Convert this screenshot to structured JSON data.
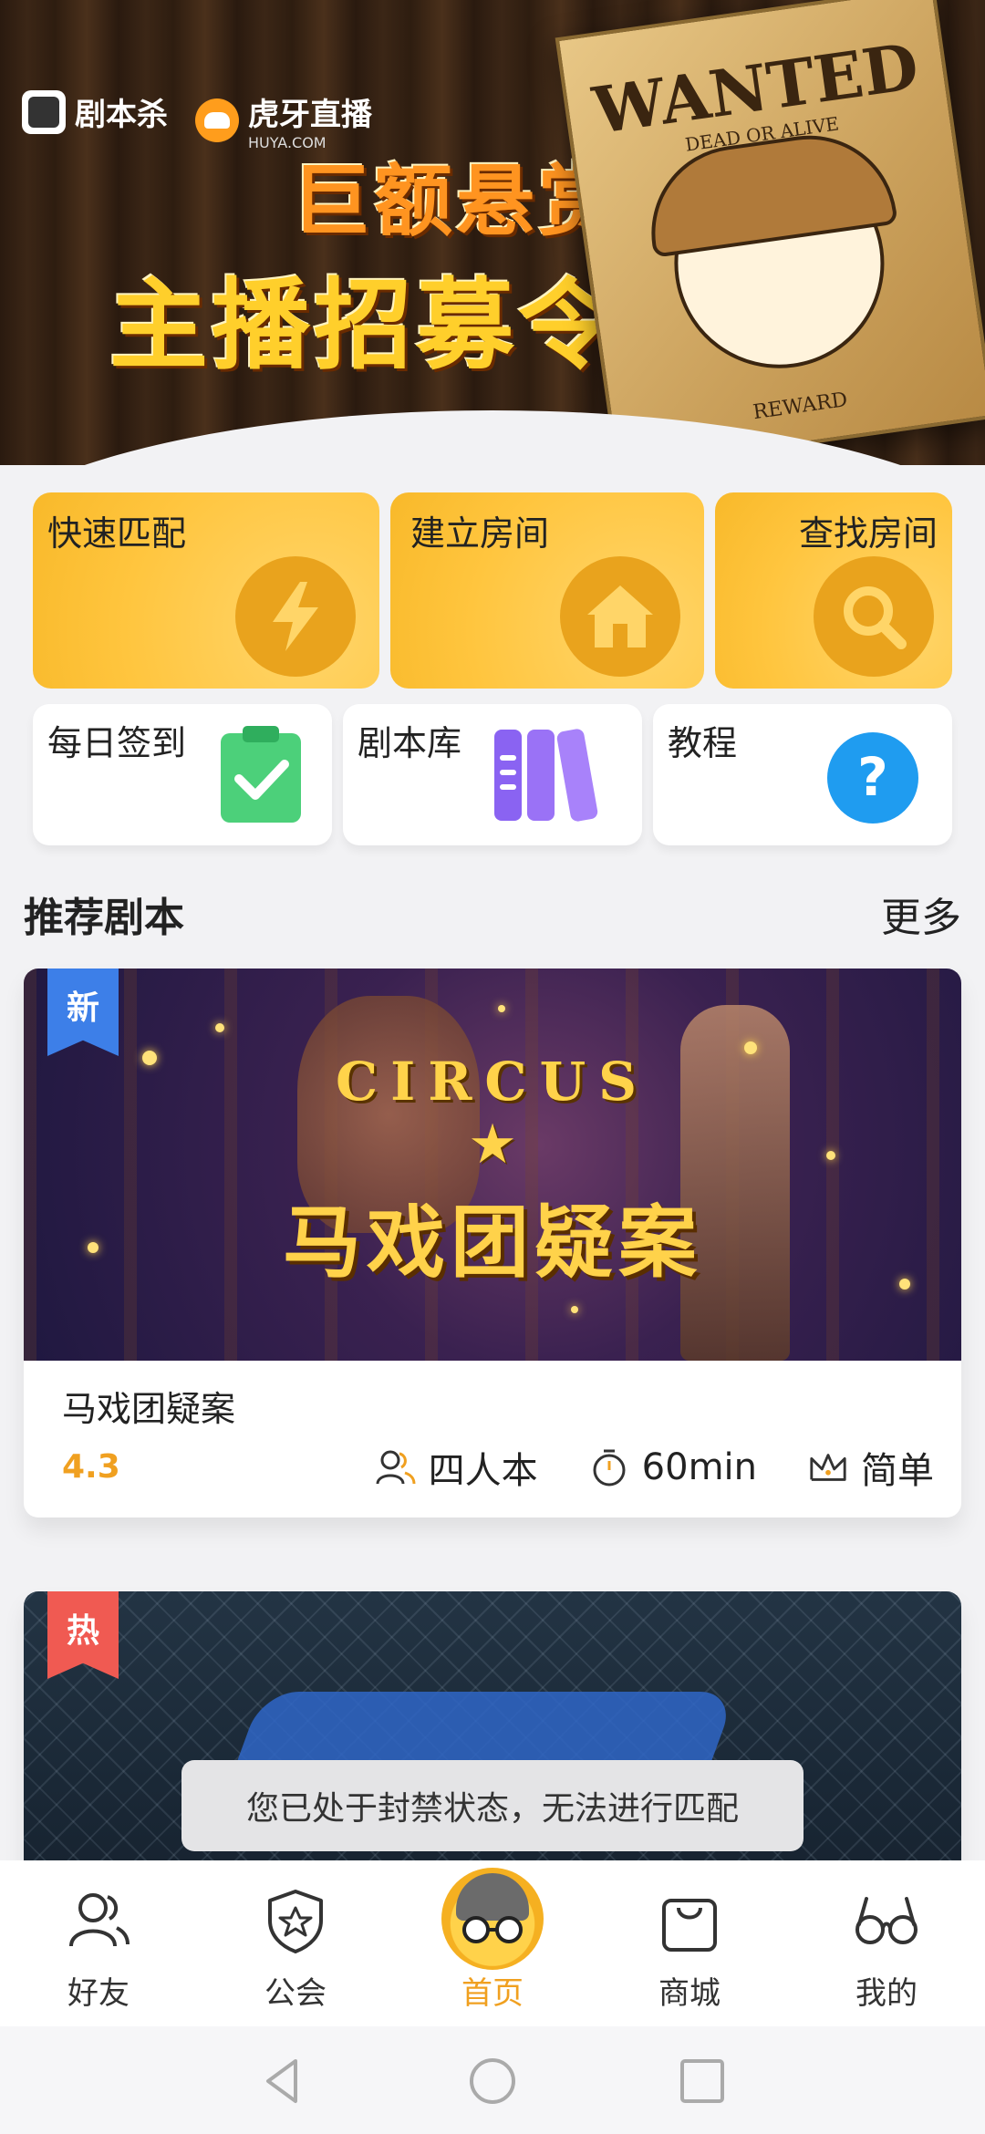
{
  "banner": {
    "brand_app": "剧本杀",
    "brand_partner": "虎牙直播",
    "brand_partner_sub": "HUYA.COM",
    "headline_1": "巨额悬赏",
    "headline_2": "主播招募令",
    "poster_title": "WANTED",
    "poster_sub": "DEAD OR ALIVE",
    "poster_footer": "REWARD"
  },
  "actions": {
    "quick_match": "快速匹配",
    "create_room": "建立房间",
    "find_room": "查找房间",
    "daily_checkin": "每日签到",
    "script_library": "剧本库",
    "tutorial": "教程"
  },
  "section": {
    "title": "推荐剧本",
    "more": "更多"
  },
  "scripts": [
    {
      "badge": "新",
      "cover_title_en": "CIRCUS",
      "cover_title_cn": "马戏团疑案",
      "name": "马戏团疑案",
      "rating": "4.3",
      "players": "四人本",
      "duration": "60min",
      "difficulty": "简单"
    },
    {
      "badge": "热"
    }
  ],
  "toast": "您已处于封禁状态，无法进行匹配",
  "bottom_nav": {
    "friends": "好友",
    "guild": "公会",
    "home": "首页",
    "shop": "商城",
    "me": "我的"
  },
  "colors": {
    "accent": "#f0a020",
    "card_yellow": "#ffc53e",
    "badge_new": "#3d7fe8",
    "badge_hot": "#f05a52"
  }
}
